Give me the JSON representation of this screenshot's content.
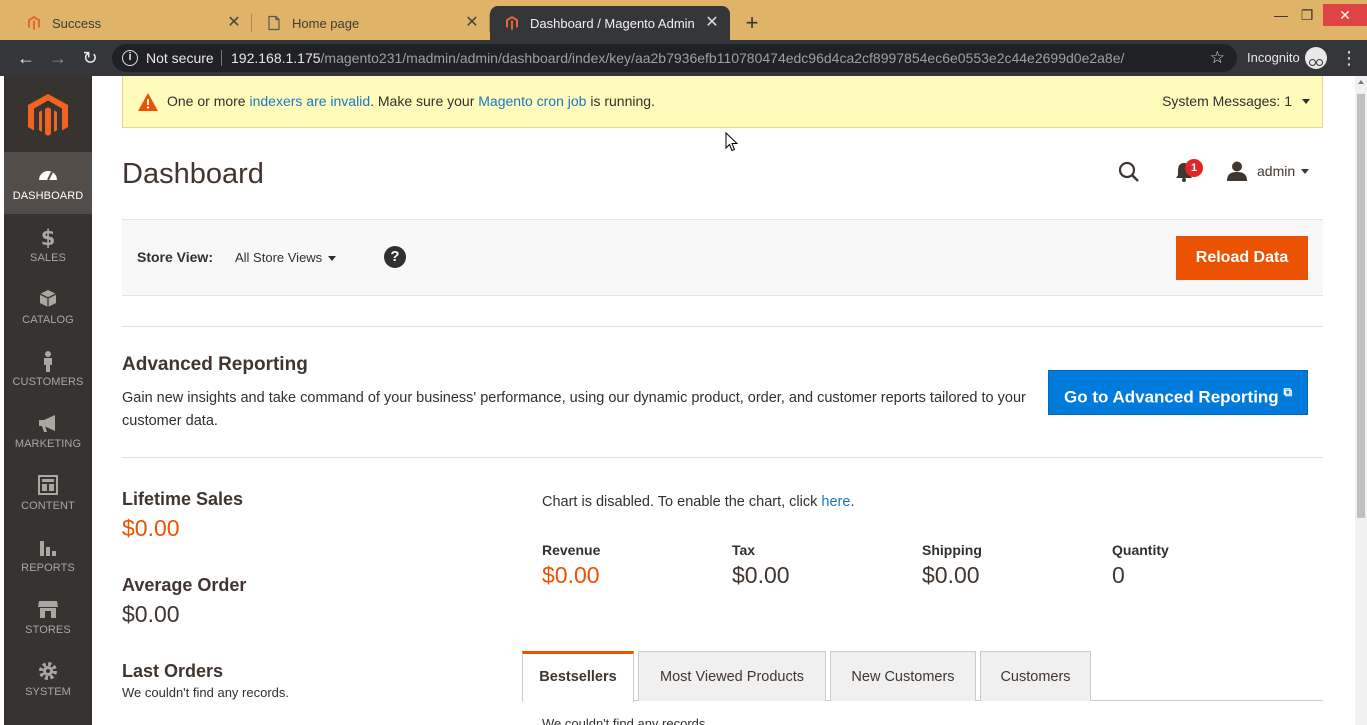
{
  "browser": {
    "tabs": [
      {
        "title": "Success",
        "active": false
      },
      {
        "title": "Home page",
        "active": false
      },
      {
        "title": "Dashboard / Magento Admin",
        "active": true
      }
    ],
    "address": {
      "security_label": "Not secure",
      "url_host": "192.168.1.175",
      "url_path": "/magento231/madmin/admin/dashboard/index/key/aa2b7936efb110780474edc96d4ca2cf8997854ec6e0553e2c44e2699d0e2a8e/"
    },
    "profile_label": "Incognito",
    "colors": {
      "tabbar": "#dfb468",
      "toolbar": "#35363a"
    }
  },
  "sidebar": {
    "items": [
      {
        "label": "DASHBOARD",
        "icon": "dashboard-icon",
        "active": true
      },
      {
        "label": "SALES",
        "icon": "dollar-icon",
        "active": false
      },
      {
        "label": "CATALOG",
        "icon": "cube-icon",
        "active": false
      },
      {
        "label": "CUSTOMERS",
        "icon": "person-icon",
        "active": false
      },
      {
        "label": "MARKETING",
        "icon": "megaphone-icon",
        "active": false
      },
      {
        "label": "CONTENT",
        "icon": "layout-icon",
        "active": false
      },
      {
        "label": "REPORTS",
        "icon": "bar-chart-icon",
        "active": false
      },
      {
        "label": "STORES",
        "icon": "store-icon",
        "active": false
      },
      {
        "label": "SYSTEM",
        "icon": "gear-icon",
        "active": false
      }
    ]
  },
  "system_message": {
    "prefix": "One or more ",
    "link1": "indexers are invalid",
    "middle": ". Make sure your ",
    "link2": "Magento cron job",
    "suffix": " is running.",
    "count_label": "System Messages: 1"
  },
  "header": {
    "title": "Dashboard",
    "notification_count": "1",
    "user": "admin"
  },
  "store_bar": {
    "label": "Store View:",
    "selected": "All Store Views",
    "help": "?",
    "reload_label": "Reload Data"
  },
  "advanced_reporting": {
    "title": "Advanced Reporting",
    "description": "Gain new insights and take command of your business' performance, using our dynamic product, order, and customer reports tailored to your customer data.",
    "button_label": "Go to Advanced Reporting"
  },
  "stats": {
    "lifetime_sales_label": "Lifetime Sales",
    "lifetime_sales_value": "$0.00",
    "average_order_label": "Average Order",
    "average_order_value": "$0.00",
    "last_orders_label": "Last Orders",
    "last_orders_empty": "We couldn't find any records."
  },
  "chart": {
    "note_prefix": "Chart is disabled. To enable the chart, click ",
    "note_link": "here",
    "note_suffix": "."
  },
  "totals": [
    {
      "label": "Revenue",
      "value": "$0.00",
      "highlight": true
    },
    {
      "label": "Tax",
      "value": "$0.00",
      "highlight": false
    },
    {
      "label": "Shipping",
      "value": "$0.00",
      "highlight": false
    },
    {
      "label": "Quantity",
      "value": "0",
      "highlight": false
    }
  ],
  "dashboard_tabs": [
    {
      "label": "Bestsellers",
      "active": true
    },
    {
      "label": "Most Viewed Products",
      "active": false
    },
    {
      "label": "New Customers",
      "active": false
    },
    {
      "label": "Customers",
      "active": false
    }
  ],
  "tab_body_text": "We couldn't find any records.",
  "colors": {
    "accent": "#eb5202",
    "primary": "#007bdb",
    "sidebar": "#373330",
    "warning_bg": "#fffbbb"
  }
}
